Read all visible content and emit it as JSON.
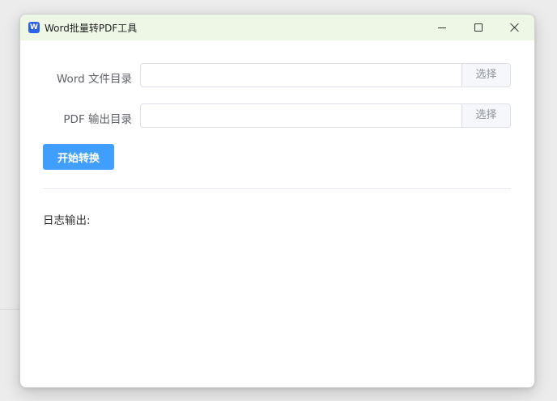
{
  "window": {
    "title": "Word批量转PDF工具",
    "app_icon": "word-doc-icon",
    "app_icon_letter": "W",
    "controls": {
      "minimize": "minimize-icon",
      "maximize": "maximize-icon",
      "close": "close-icon"
    }
  },
  "form": {
    "word_dir": {
      "label": "Word 文件目录",
      "value": "",
      "placeholder": "",
      "button_label": "选择"
    },
    "pdf_dir": {
      "label": "PDF 输出目录",
      "value": "",
      "placeholder": "",
      "button_label": "选择"
    },
    "start_button_label": "开始转换"
  },
  "log": {
    "label": "日志输出:"
  },
  "colors": {
    "titlebar_bg": "#eef7e6",
    "primary": "#409eff",
    "app_icon_bg": "#2b62e8"
  }
}
